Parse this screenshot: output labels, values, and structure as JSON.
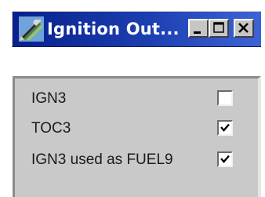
{
  "window": {
    "title": "Ignition Out...",
    "app_icon": "wrench-pencil-icon",
    "title_gradient": [
      "#08208e",
      "#3d64d6"
    ]
  },
  "titlebar_buttons": {
    "minimize": "minimize-icon",
    "maximize": "maximize-icon",
    "close": "close-icon"
  },
  "options": [
    {
      "label": "IGN3",
      "checked": false
    },
    {
      "label": "TOC3",
      "checked": true
    },
    {
      "label": "IGN3 used as FUEL9",
      "checked": true
    }
  ],
  "colors": {
    "panel_bg": "#c9c9c9",
    "check_color": "#000000"
  }
}
